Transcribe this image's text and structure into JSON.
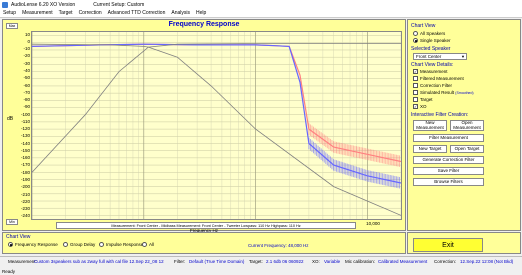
{
  "window": {
    "title": "AudioLense 6.20 XO Version",
    "setup": "Current Setup: Custom"
  },
  "menu": [
    "Setup",
    "Measurement",
    "Target",
    "Correction",
    "Advanced TTD Correction",
    "Analysis",
    "Help"
  ],
  "plot": {
    "title": "Frequency Response",
    "ylabel": "dB",
    "yticks": [
      "10",
      "0",
      "-10",
      "-20",
      "-30",
      "-40",
      "-50",
      "-60",
      "-70",
      "-80",
      "-90",
      "-100",
      "-110",
      "-120",
      "-130",
      "-140",
      "-150",
      "-160",
      "-170",
      "-180",
      "-190",
      "-200",
      "-210",
      "-220",
      "-230",
      "-240"
    ],
    "xticks": [
      "10",
      "100",
      "1,000",
      "10,000"
    ],
    "xlabel": "Frequency Hz",
    "max_btn": "Max",
    "min_btn": "Min",
    "legend": "Measurement: Front Center - Midbass     Measurement: Front Center - Tweeter     Lowpass: 110 Hz     Highpass: 110 Hz"
  },
  "chart_data": {
    "type": "line",
    "title": "Frequency Response",
    "xlabel": "Frequency Hz",
    "ylabel": "dB",
    "xscale": "log",
    "xlim": [
      10,
      20000
    ],
    "ylim": [
      -245,
      15
    ],
    "grid": true,
    "series": [
      {
        "name": "Measurement: Front Center - Midbass",
        "color": "#ff8080",
        "x": [
          10,
          20,
          40,
          100,
          300,
          1000,
          1500,
          2000,
          2500,
          3000,
          5000,
          10000,
          20000
        ],
        "y": [
          -5,
          -4,
          -3,
          -2,
          -3,
          -3,
          -4,
          -5,
          -45,
          -120,
          -145,
          -155,
          -165
        ]
      },
      {
        "name": "Measurement: Front Center - Tweeter",
        "color": "#6666ff",
        "x": [
          10,
          20,
          40,
          100,
          300,
          1000,
          1500,
          2000,
          2500,
          3000,
          5000,
          10000,
          20000
        ],
        "y": [
          -5,
          -4,
          -3,
          -2,
          -3,
          -3,
          -4,
          -5,
          -55,
          -140,
          -170,
          -185,
          -195
        ]
      },
      {
        "name": "Lowpass: 110 Hz",
        "color": "#808080",
        "x": [
          10,
          50,
          100,
          110,
          200,
          400,
          1000,
          5000,
          20000
        ],
        "y": [
          -2,
          -3,
          -5,
          -6,
          -20,
          -60,
          -120,
          -200,
          -240
        ]
      },
      {
        "name": "Highpass: 110 Hz",
        "color": "#808080",
        "x": [
          10,
          30,
          60,
          110,
          200,
          1000,
          5000,
          20000
        ],
        "y": [
          -180,
          -100,
          -40,
          -6,
          -2,
          -1,
          -1,
          -1
        ]
      }
    ]
  },
  "side": {
    "chartview_title": "Chart View",
    "all_speakers": "All Speakers",
    "single_speaker": "Single Speaker",
    "selected_title": "Selected Speaker",
    "speaker": "Front Center",
    "details_title": "Chart View Details:",
    "details": [
      {
        "label": "Measurement",
        "checked": true
      },
      {
        "label": "Filtered Measurement",
        "checked": false
      },
      {
        "label": "Correction Filter",
        "checked": false
      },
      {
        "label": "Simulated Result",
        "note": "(Smoothed)",
        "checked": false
      },
      {
        "label": "Target",
        "checked": false
      },
      {
        "label": "XO",
        "checked": true
      }
    ],
    "interactive_title": "Interactive Filter Creation:",
    "new_measurement": "New Measurement",
    "open_measurement": "Open Measurement",
    "filter_measurement": "Filter Measurement",
    "new_target": "New Target",
    "open_target": "Open Target",
    "generate": "Generate Correction Filter",
    "save_filter": "Save Filter",
    "browse": "Browse Filters"
  },
  "bottom": {
    "chartview_title": "Chart View",
    "options": [
      "Frequency Response",
      "Group Delay",
      "Impulse Response",
      "All"
    ],
    "current_frequency": "Current Frequency: 48,000 Hz",
    "exit": "Exit"
  },
  "status": {
    "measurement_label": "Measurement:",
    "measurement_value": "Custom 3speakers sub as 2way full with cal file 12.Sep 22_08 12",
    "filter_label": "Filter:",
    "filter_value": "Default (True Time Domain)",
    "target_label": "Target:",
    "target_value": "2.1 6db 06 060922",
    "xo_label": "XO:",
    "xo_value": "Variable",
    "mic_label": "Mic calibration:",
    "mic_value": "Calibrated Measurement",
    "correction_label": "Correction:",
    "correction_value": "12.Sep.22 12:08 (Not Bkd)",
    "ready": "Ready"
  }
}
